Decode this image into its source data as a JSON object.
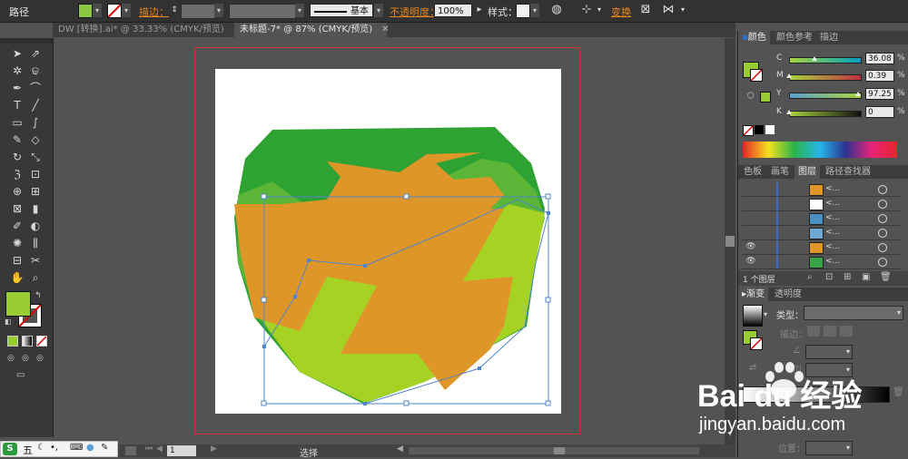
{
  "control_bar": {
    "object_type": "路径",
    "stroke_label": "描边：",
    "stroke_style": "基本",
    "opacity_label": "不透明度：",
    "opacity_value": "100%",
    "style_label": "样式：",
    "transform_label": "变换",
    "fill_color": "#8dc63f"
  },
  "tabs": [
    {
      "label": "DW [转换].ai* @ 33.33% (CMYK/预览)",
      "active": false
    },
    {
      "label": "未标题-7* @ 87% (CMYK/预览)",
      "active": true
    }
  ],
  "tab_close_glyph": "✕",
  "tools": [
    "selection-tool",
    "direct-selection-tool",
    "magic-wand-tool",
    "lasso-tool",
    "pen-tool",
    "curvature-tool",
    "type-tool",
    "line-tool",
    "rectangle-tool",
    "paintbrush-tool",
    "pencil-tool",
    "eraser-tool",
    "rotate-tool",
    "scale-tool",
    "warp-tool",
    "free-transform-tool",
    "shape-builder-tool",
    "perspective-grid-tool",
    "mesh-tool",
    "gradient-tool",
    "eyedropper-tool",
    "blend-tool",
    "symbol-sprayer-tool",
    "column-graph-tool",
    "artboard-tool",
    "slice-tool",
    "hand-tool",
    "zoom-tool"
  ],
  "tool_glyphs": [
    "➤",
    "⇗",
    "✲",
    "ଢ",
    "✒",
    "⌒",
    "T",
    "╱",
    "▭",
    "∫",
    "✎",
    "◇",
    "↻",
    "⤡",
    "ℨ",
    "⊡",
    "⊕",
    "⊞",
    "⊠",
    "▮",
    "✐",
    "◐",
    "✺",
    "⫼",
    "⊟",
    "✂",
    "✋",
    "⌕"
  ],
  "toolbar_fill": "#99cc33",
  "canvas": {
    "shapes": {
      "dark_green": "#2ea232",
      "mid_green": "#5bb536",
      "light_green": "#a6d323",
      "orange": "#df9628",
      "path_stroke": "#4f86c6"
    }
  },
  "color_panel": {
    "tabs": [
      "颜色",
      "颜色参考",
      "描边"
    ],
    "active_tab": 0,
    "sliders": [
      {
        "label": "C",
        "value": "36.08",
        "frac": 0.36,
        "track": "cyan"
      },
      {
        "label": "M",
        "value": "0.39",
        "frac": 0.004,
        "track": "magenta"
      },
      {
        "label": "Y",
        "value": "97.25",
        "frac": 0.97,
        "track": "yellow"
      },
      {
        "label": "K",
        "value": "0",
        "frac": 0.0,
        "track": "black"
      }
    ],
    "pct": "%"
  },
  "layers_panel": {
    "tabs": [
      "色板",
      "画笔",
      "图层",
      "路径查找器"
    ],
    "active_tab": 2,
    "rows": [
      {
        "visible": false,
        "name": "<...",
        "thumb": "#df9628"
      },
      {
        "visible": false,
        "name": "<...",
        "thumb": "#ffffff"
      },
      {
        "visible": false,
        "name": "<...",
        "thumb": "#4a90c2"
      },
      {
        "visible": false,
        "name": "<...",
        "thumb": "#6fa8d0"
      },
      {
        "visible": true,
        "name": "<...",
        "thumb": "#df9628"
      },
      {
        "visible": true,
        "name": "<...",
        "thumb": "#3aa348"
      }
    ],
    "eye_glyph": "👁",
    "footer": "1 个图层"
  },
  "gradient_panel": {
    "tabs": [
      "渐变",
      "透明度"
    ],
    "active_tab": 0,
    "type_label": "类型：",
    "stroke_label": "描边：",
    "position_label": "位置："
  },
  "status": {
    "zoom_value": "1",
    "selection_text": "选择"
  },
  "ime_bar": {
    "label": "五"
  },
  "watermark": {
    "brand": "Bai du 经验",
    "url": "jingyan.baidu.com"
  }
}
